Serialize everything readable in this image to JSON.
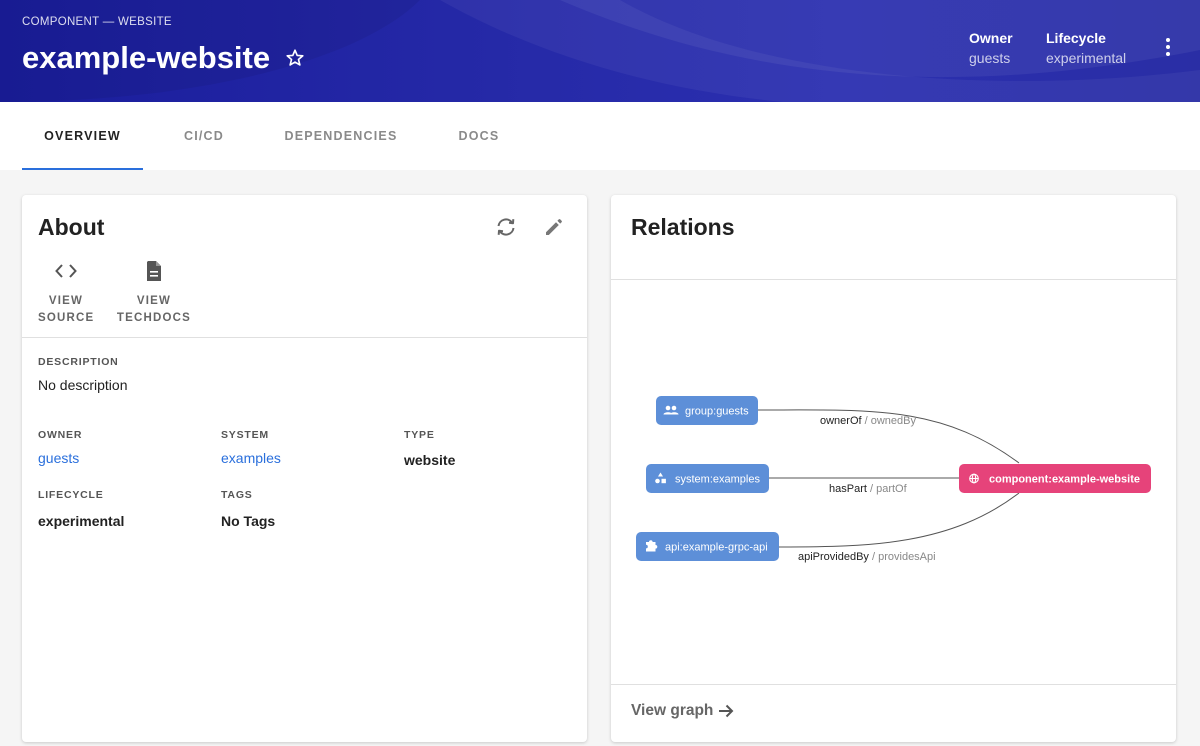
{
  "header": {
    "breadcrumb": "COMPONENT — WEBSITE",
    "title": "example-website",
    "owner_label": "Owner",
    "owner_value": "guests",
    "lifecycle_label": "Lifecycle",
    "lifecycle_value": "experimental"
  },
  "tabs": [
    {
      "label": "OVERVIEW"
    },
    {
      "label": "CI/CD"
    },
    {
      "label": "DEPENDENCIES"
    },
    {
      "label": "DOCS"
    }
  ],
  "about": {
    "title": "About",
    "view_source": [
      "VIEW",
      "SOURCE"
    ],
    "view_techdocs": [
      "VIEW",
      "TECHDOCS"
    ],
    "description_label": "DESCRIPTION",
    "description_value": "No description",
    "owner_label": "OWNER",
    "owner_value": "guests",
    "system_label": "SYSTEM",
    "system_value": "examples",
    "type_label": "TYPE",
    "type_value": "website",
    "lifecycle_label": "LIFECYCLE",
    "lifecycle_value": "experimental",
    "tags_label": "TAGS",
    "tags_value": "No Tags"
  },
  "relations": {
    "title": "Relations",
    "nodes": {
      "group": "group:guests",
      "system": "system:examples",
      "api": "api:example-grpc-api",
      "component": "component:example-website"
    },
    "edges": {
      "owner": {
        "primary": "ownerOf",
        "secondary": " / ownedBy"
      },
      "part": {
        "primary": "hasPart",
        "secondary": " / partOf"
      },
      "api": {
        "primary": "apiProvidedBy",
        "secondary": " / providesApi"
      }
    },
    "view_graph": "View graph"
  },
  "colors": {
    "header_bg": "#2528a6",
    "accent": "#2a6fdc",
    "node_blue": "#5d8fd8",
    "node_pink": "#e6437a"
  }
}
